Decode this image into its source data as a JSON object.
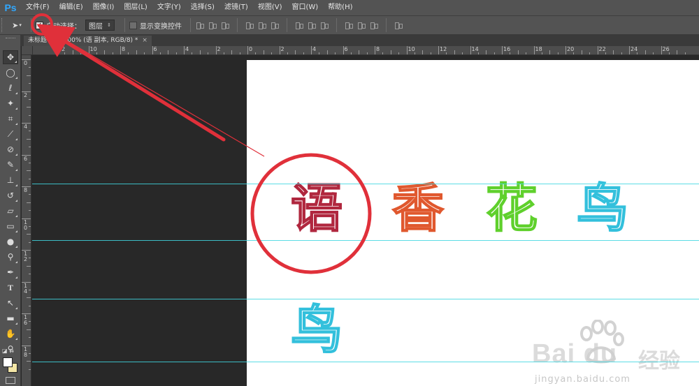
{
  "app": {
    "logo": "Ps"
  },
  "menu": [
    "文件(F)",
    "编辑(E)",
    "图像(I)",
    "图层(L)",
    "文字(Y)",
    "选择(S)",
    "滤镜(T)",
    "视图(V)",
    "窗口(W)",
    "帮助(H)"
  ],
  "options": {
    "auto_select_label": "自动选择：",
    "auto_select_checked": true,
    "auto_select_target": "图层",
    "show_transform_label": "显示变换控件",
    "show_transform_checked": false
  },
  "document": {
    "tab_title": "未标题-1 @ 100% (语 副本, RGB/8) *",
    "tab_close": "×"
  },
  "ruler": {
    "h_labels": [
      "12",
      "10",
      "8",
      "6",
      "4",
      "2",
      "0",
      "2",
      "4",
      "6",
      "8",
      "10",
      "12",
      "14",
      "16",
      "18",
      "20",
      "22",
      "24",
      "26"
    ],
    "v_labels": [
      "0",
      "2",
      "4",
      "6",
      "8",
      "10",
      "12",
      "14",
      "16",
      "18"
    ]
  },
  "canvas": {
    "glyphs": [
      "语",
      "香",
      "花",
      "鸟",
      "鸟"
    ],
    "colors": {
      "red": "#b0273e",
      "orange": "#e0582e",
      "green": "#5fd02c",
      "cyan": "#33c0dc",
      "guide": "#3fd6e0",
      "annotation": "#e0303a"
    }
  },
  "watermark": {
    "brand": "Bai du",
    "cn": "经验",
    "url": "jingyan.baidu.com"
  },
  "tools": [
    "move-tool",
    "marquee-tool",
    "lasso-tool",
    "magic-wand-tool",
    "crop-tool",
    "eyedropper-tool",
    "healing-brush-tool",
    "brush-tool",
    "clone-stamp-tool",
    "history-brush-tool",
    "eraser-tool",
    "gradient-tool",
    "blur-tool",
    "dodge-tool",
    "pen-tool",
    "type-tool",
    "path-selection-tool",
    "shape-tool",
    "hand-tool",
    "zoom-tool"
  ],
  "tool_glyphs": {
    "type": "T"
  }
}
